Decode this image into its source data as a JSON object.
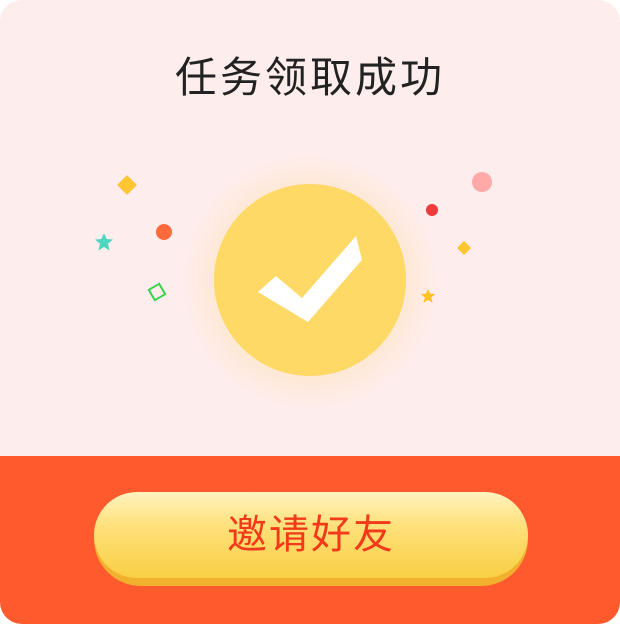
{
  "dialog": {
    "title": "任务领取成功",
    "invite_button_label": "邀请好友"
  },
  "icons": {
    "status": "checkmark-icon",
    "decorations": [
      "confetti-diamond-icon",
      "confetti-dot-icon",
      "confetti-star-icon",
      "confetti-square-outline-icon"
    ]
  },
  "colors": {
    "background": "#feeded",
    "accent": "#ff5a2e",
    "success_circle": "#ffd966",
    "button_text": "#f23a1a",
    "title_text": "#222222"
  }
}
